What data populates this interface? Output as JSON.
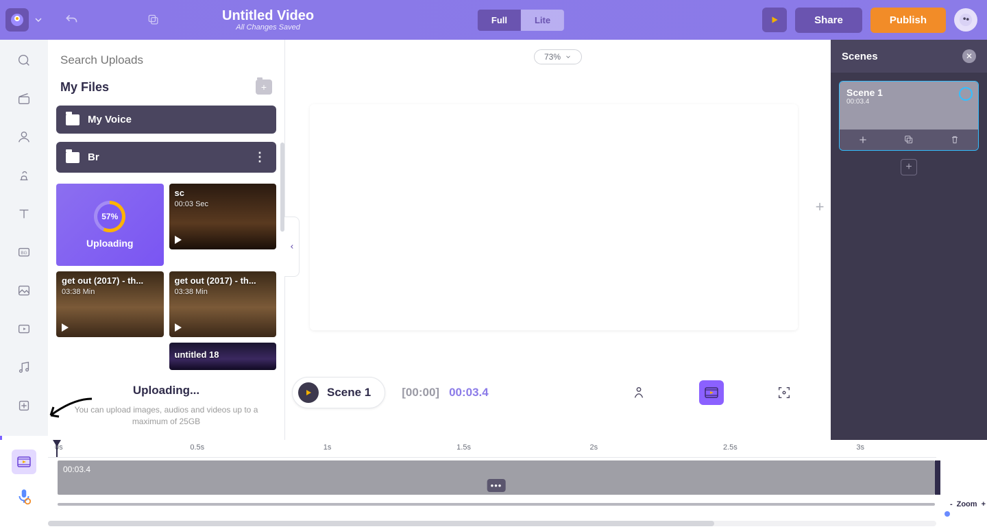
{
  "header": {
    "title": "Untitled Video",
    "subtitle": "All Changes Saved",
    "mode_full": "Full",
    "mode_lite": "Lite",
    "share": "Share",
    "publish": "Publish"
  },
  "zoom_pill": "73%",
  "uploads": {
    "search_placeholder": "Search Uploads",
    "files_heading": "My Files",
    "folders": [
      {
        "name": "My Voice"
      },
      {
        "name": "Br"
      }
    ],
    "uploading_percent": "57%",
    "uploading_label": "Uploading",
    "items": [
      {
        "title": "sc",
        "duration": "00:03 Sec"
      },
      {
        "title": "get out (2017) - th...",
        "duration": "03:38 Min"
      },
      {
        "title": "get out (2017) - th...",
        "duration": "03:38 Min"
      },
      {
        "title": "untitled 18",
        "duration": ""
      }
    ],
    "footer_status": "Uploading...",
    "footer_hint": "You can upload images, audios and videos up to a maximum of 25GB"
  },
  "scenes_panel": {
    "title": "Scenes",
    "scene_name": "Scene 1",
    "scene_time": "00:03.4"
  },
  "midstrip": {
    "scene_label": "Scene 1",
    "time_current": "[00:00]",
    "time_duration": "00:03.4"
  },
  "timeline": {
    "ticks": [
      "0s",
      "0.5s",
      "1s",
      "1.5s",
      "2s",
      "2.5s",
      "3s"
    ],
    "clip_label": "00:03.4",
    "zoom_label": "Zoom",
    "zoom_minus": "-",
    "zoom_plus": "+"
  }
}
